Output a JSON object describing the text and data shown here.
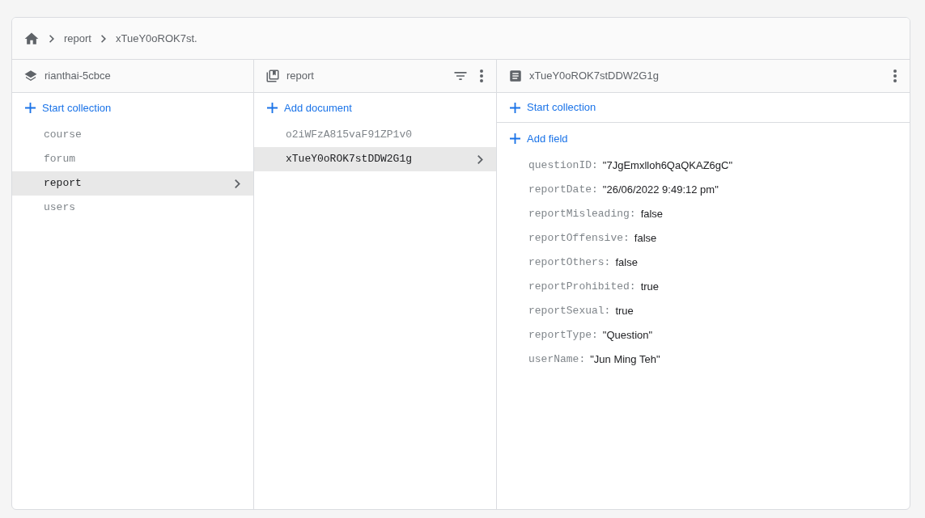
{
  "breadcrumb": [
    "report",
    "xTueY0oROK7st."
  ],
  "columns": [
    {
      "kind": "root",
      "title": "rianthai-5cbce",
      "action": "Start collection",
      "items": [
        {
          "label": "course",
          "selected": false
        },
        {
          "label": "forum",
          "selected": false
        },
        {
          "label": "report",
          "selected": true
        },
        {
          "label": "users",
          "selected": false
        }
      ]
    },
    {
      "kind": "collection",
      "title": "report",
      "action": "Add document",
      "items": [
        {
          "label": "o2iWFzA815vaF91ZP1v0",
          "selected": false
        },
        {
          "label": "xTueY0oROK7stDDW2G1g",
          "selected": true
        }
      ]
    },
    {
      "kind": "document",
      "title": "xTueY0oROK7stDDW2G1g",
      "action": "Start collection",
      "field_action": "Add field",
      "fields": [
        {
          "key": "questionID:",
          "value": "\"7JgEmxlloh6QaQKAZ6gC\""
        },
        {
          "key": "reportDate:",
          "value": "\"26/06/2022 9:49:12 pm\""
        },
        {
          "key": "reportMisleading:",
          "value": "false"
        },
        {
          "key": "reportOffensive:",
          "value": "false"
        },
        {
          "key": "reportOthers:",
          "value": "false"
        },
        {
          "key": "reportProhibited:",
          "value": "true"
        },
        {
          "key": "reportSexual:",
          "value": "true"
        },
        {
          "key": "reportType:",
          "value": "\"Question\""
        },
        {
          "key": "userName:",
          "value": "\"Jun Ming Teh\""
        }
      ]
    }
  ]
}
